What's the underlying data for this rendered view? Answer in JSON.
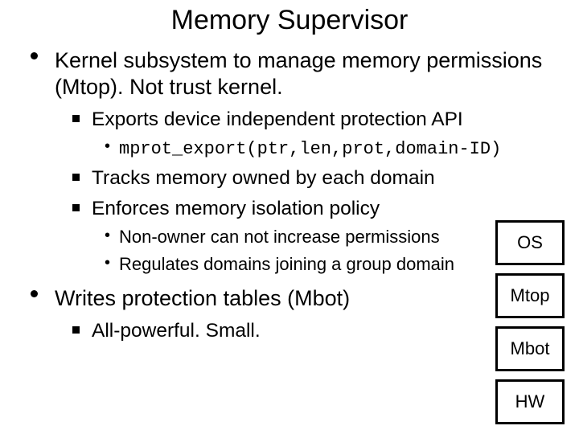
{
  "title": "Memory Supervisor",
  "bullets": [
    {
      "text": "Kernel subsystem to manage memory permissions (Mtop).  Not trust kernel.",
      "sub": [
        {
          "text": "Exports device independent protection API",
          "subsub": [
            {
              "text": "mprot_export(ptr,len,prot,domain-ID)",
              "mono": true
            }
          ]
        },
        {
          "text": "Tracks memory owned by each domain"
        },
        {
          "text": "Enforces memory isolation policy",
          "subsub": [
            {
              "text": "Non-owner can not increase permissions"
            },
            {
              "text": "Regulates domains joining a group domain"
            }
          ]
        }
      ]
    },
    {
      "text": "Writes protection tables (Mbot)",
      "sub": [
        {
          "text": "All-powerful.  Small."
        }
      ]
    }
  ],
  "stack": [
    "OS",
    "Mtop",
    "Mbot",
    "HW"
  ]
}
